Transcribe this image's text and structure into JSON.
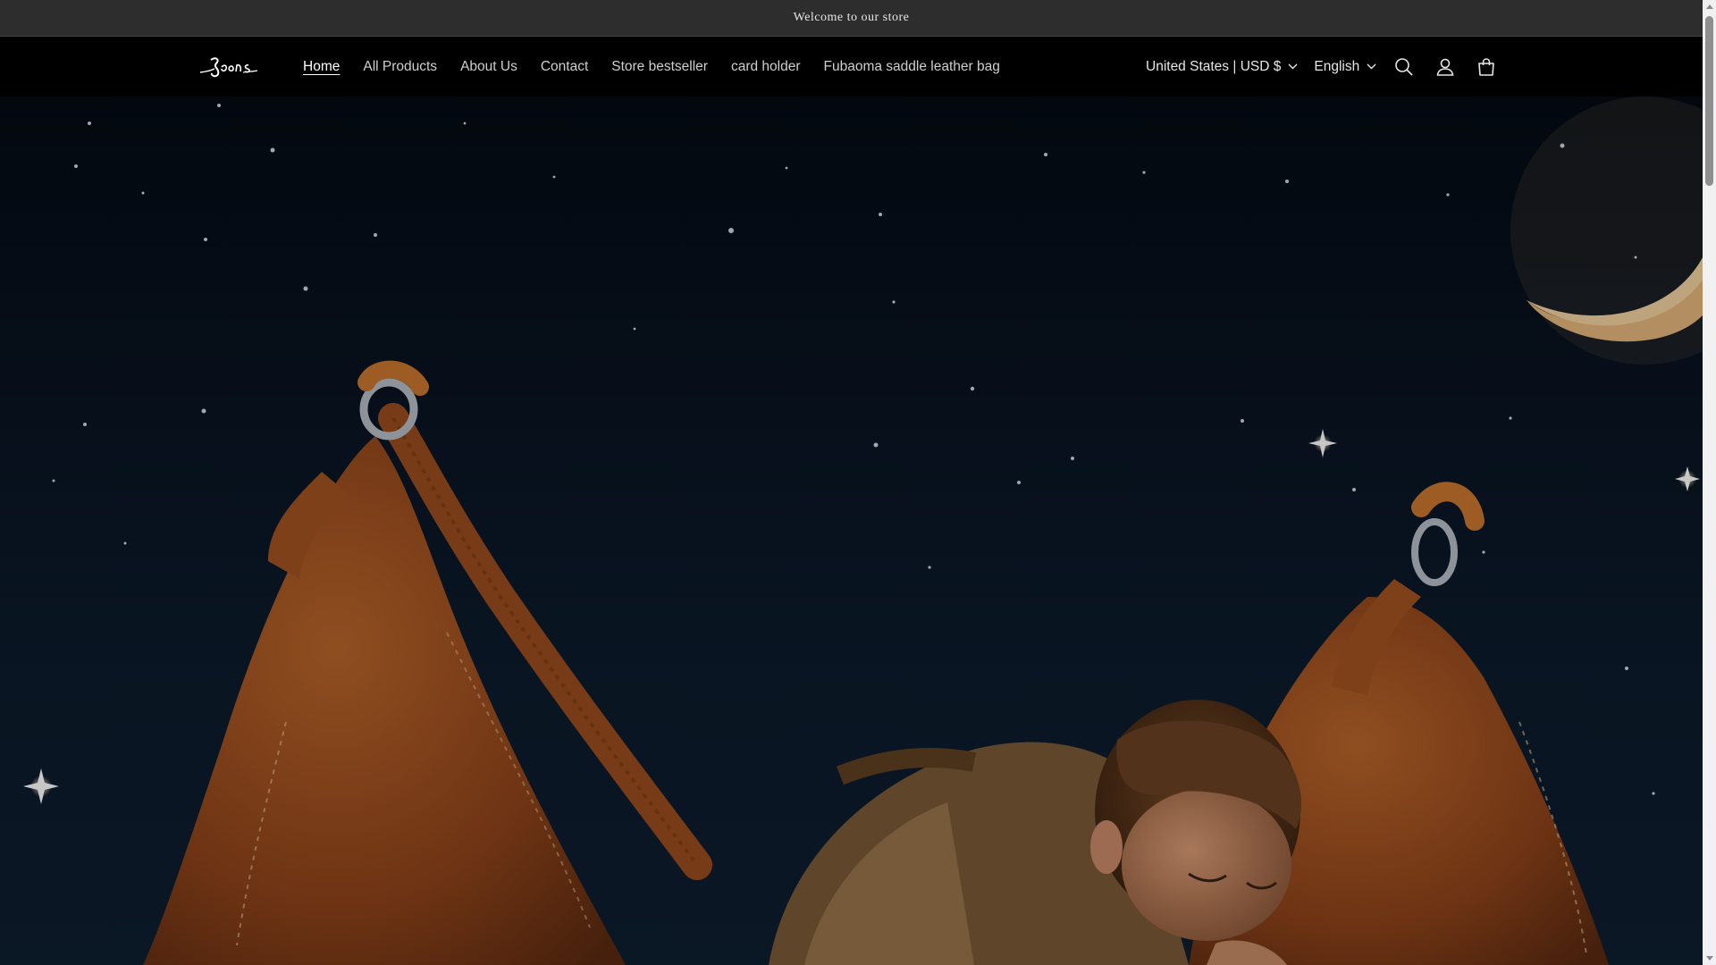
{
  "announcement": {
    "text": "Welcome to our store"
  },
  "header": {
    "logo_text": "Spons",
    "nav": [
      {
        "label": "Home",
        "active": true
      },
      {
        "label": "All Products",
        "active": false
      },
      {
        "label": "About Us",
        "active": false
      },
      {
        "label": "Contact",
        "active": false
      },
      {
        "label": "Store bestseller",
        "active": false
      },
      {
        "label": "card holder",
        "active": false
      },
      {
        "label": "Fubaoma saddle leather bag",
        "active": false
      }
    ],
    "country_selector": "United States | USD $",
    "language_selector": "English",
    "icons": [
      "search-icon",
      "account-icon",
      "cart-icon"
    ]
  },
  "hero": {
    "description_icons": [
      "crescent-moon",
      "stars"
    ],
    "colors": {
      "sky": "#0b1522",
      "leather": "#9a4c1e",
      "leather_light": "#c0702f"
    }
  },
  "theme": {
    "announcement_bg": "#2d2d2d",
    "header_bg": "#000000",
    "nav_text": "#cfcfcf",
    "nav_active": "#ffffff"
  }
}
